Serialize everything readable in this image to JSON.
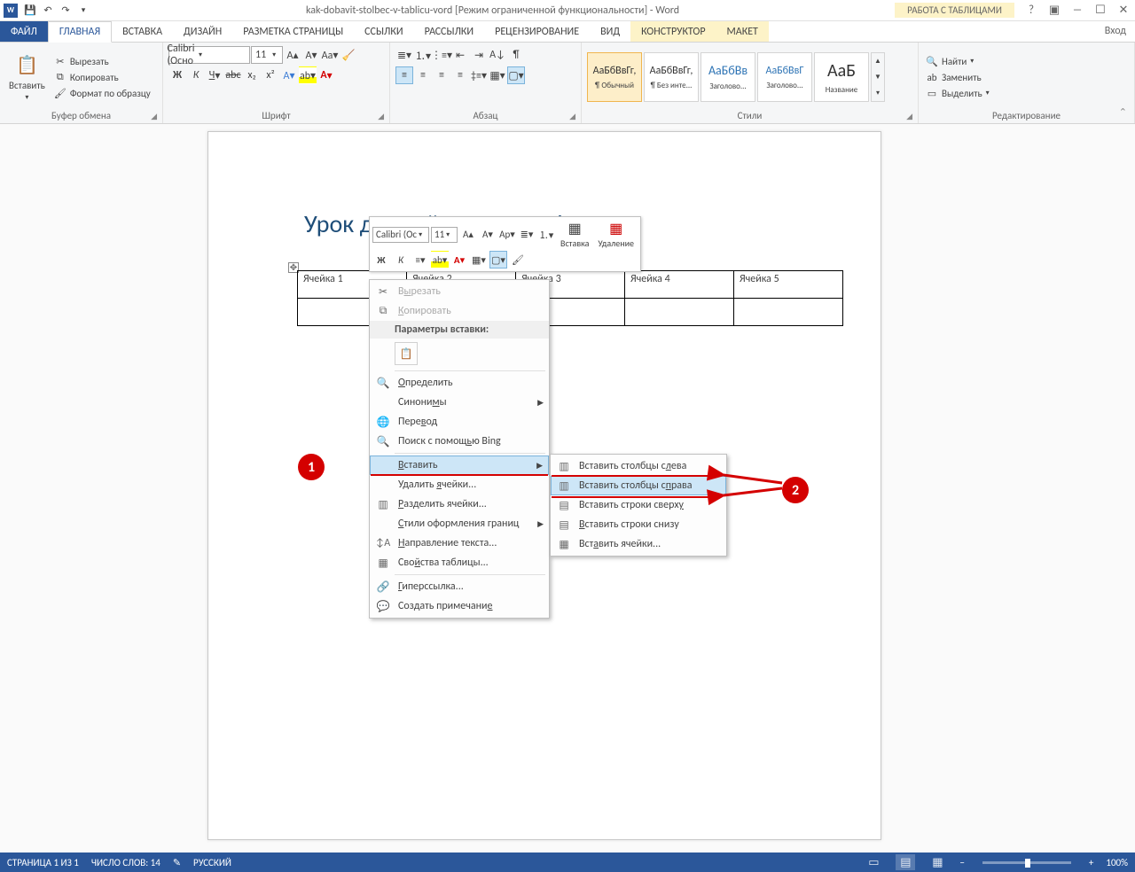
{
  "title": "kak-dobavit-stolbec-v-tablicu-vord [Режим ограниченной функциональности] - Word",
  "table_tools_label": "РАБОТА С ТАБЛИЦАМИ",
  "login_label": "Вход",
  "tabs": {
    "file": "ФАЙЛ",
    "home": "ГЛАВНАЯ",
    "insert": "ВСТАВКА",
    "design": "ДИЗАЙН",
    "layout": "РАЗМЕТКА СТРАНИЦЫ",
    "references": "ССЫЛКИ",
    "mailings": "РАССЫЛКИ",
    "review": "РЕЦЕНЗИРОВАНИЕ",
    "view": "ВИД",
    "constructor": "КОНСТРУКТОР",
    "tlayout": "МАКЕТ"
  },
  "ribbon": {
    "clipboard": {
      "paste": "Вставить",
      "cut": "Вырезать",
      "copy": "Копировать",
      "painter": "Формат по образцу",
      "label": "Буфер обмена"
    },
    "font": {
      "name": "Calibri (Осно",
      "size": "11",
      "label": "Шрифт"
    },
    "paragraph": {
      "label": "Абзац"
    },
    "styles": {
      "label": "Стили",
      "items": [
        {
          "preview": "АаБбВвГг,",
          "name": "¶ Обычный"
        },
        {
          "preview": "АаБбВвГг,",
          "name": "¶ Без инте..."
        },
        {
          "preview": "АаБбВв",
          "name": "Заголово..."
        },
        {
          "preview": "АаБбВвГ",
          "name": "Заголово..."
        },
        {
          "preview": "АаБ",
          "name": "Название"
        }
      ]
    },
    "editing": {
      "find": "Найти",
      "replace": "Заменить",
      "select": "Выделить",
      "label": "Редактирование"
    }
  },
  "document": {
    "heading": "Урок для сайта paratapok.ru",
    "cells": [
      "Ячейка 1",
      "Ячейка 2",
      "Ячейка 3",
      "Ячейка 4",
      "Ячейка 5"
    ]
  },
  "mini_toolbar": {
    "font": "Calibri (Ос",
    "size": "11",
    "insert": "Вставка",
    "delete": "Удаление"
  },
  "context_menu": {
    "cut": "Вырезать",
    "copy": "Копировать",
    "paste_options": "Параметры вставки:",
    "define": "Определить",
    "synonyms": "Синонимы",
    "translate": "Перевод",
    "bing": "Поиск с помощью Bing",
    "insert": "Вставить",
    "delete_cells": "Удалить ячейки...",
    "split_cells": "Разделить ячейки...",
    "border_styles": "Стили оформления границ",
    "text_direction": "Направление текста...",
    "table_props": "Свойства таблицы...",
    "hyperlink": "Гиперссылка...",
    "comment": "Создать примечание"
  },
  "submenu": {
    "cols_left": "Вставить столбцы слева",
    "cols_right": "Вставить столбцы справа",
    "rows_above": "Вставить строки сверху",
    "rows_below": "Вставить строки снизу",
    "cells": "Вставить ячейки..."
  },
  "badges": {
    "one": "1",
    "two": "2"
  },
  "status": {
    "page": "СТРАНИЦА 1 ИЗ 1",
    "words": "ЧИСЛО СЛОВ: 14",
    "lang": "РУССКИЙ",
    "zoom": "100%"
  }
}
